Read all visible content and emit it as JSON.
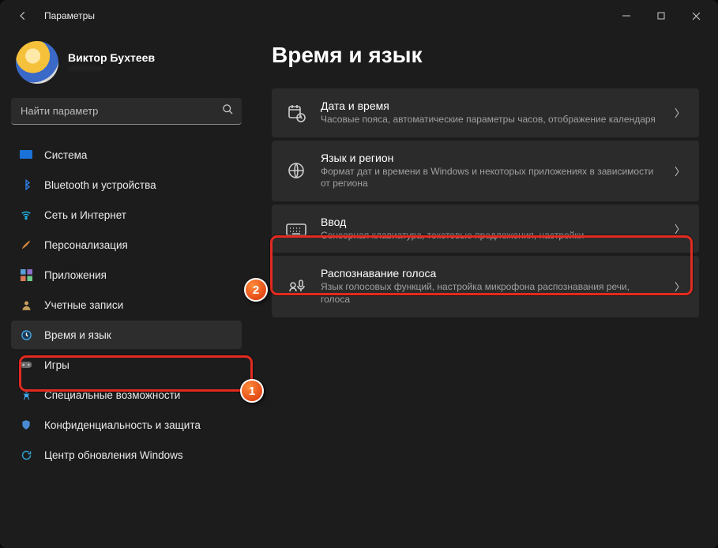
{
  "window_title": "Параметры",
  "user": {
    "name": "Виктор Бухтеев",
    "email": "············"
  },
  "search": {
    "placeholder": "Найти параметр"
  },
  "nav": [
    {
      "label": "Система",
      "icon": "system-icon"
    },
    {
      "label": "Bluetooth и устройства",
      "icon": "bluetooth-icon"
    },
    {
      "label": "Сеть и Интернет",
      "icon": "wifi-icon"
    },
    {
      "label": "Персонализация",
      "icon": "brush-icon"
    },
    {
      "label": "Приложения",
      "icon": "apps-icon"
    },
    {
      "label": "Учетные записи",
      "icon": "person-icon"
    },
    {
      "label": "Время и язык",
      "icon": "clock-icon"
    },
    {
      "label": "Игры",
      "icon": "game-icon"
    },
    {
      "label": "Специальные возможности",
      "icon": "accessibility-icon"
    },
    {
      "label": "Конфиденциальность и защита",
      "icon": "shield-icon"
    },
    {
      "label": "Центр обновления Windows",
      "icon": "update-icon"
    }
  ],
  "nav_active_index": 6,
  "page": {
    "title": "Время и язык",
    "cards": [
      {
        "title": "Дата и время",
        "sub": "Часовые пояса, автоматические параметры часов, отображение календаря",
        "icon": "calendar-clock-icon"
      },
      {
        "title": "Язык и регион",
        "sub": "Формат дат и времени в Windows и некоторых приложениях в зависимости от региона",
        "icon": "globe-lang-icon"
      },
      {
        "title": "Ввод",
        "sub": "Сенсорная клавиатура, текстовые предложения, настройки",
        "icon": "keyboard-icon"
      },
      {
        "title": "Распознавание голоса",
        "sub": "Язык голосовых функций, настройка микрофона распознавания речи, голоса",
        "icon": "mic-icon"
      }
    ]
  },
  "annotations": {
    "badge1": "1",
    "badge2": "2"
  }
}
